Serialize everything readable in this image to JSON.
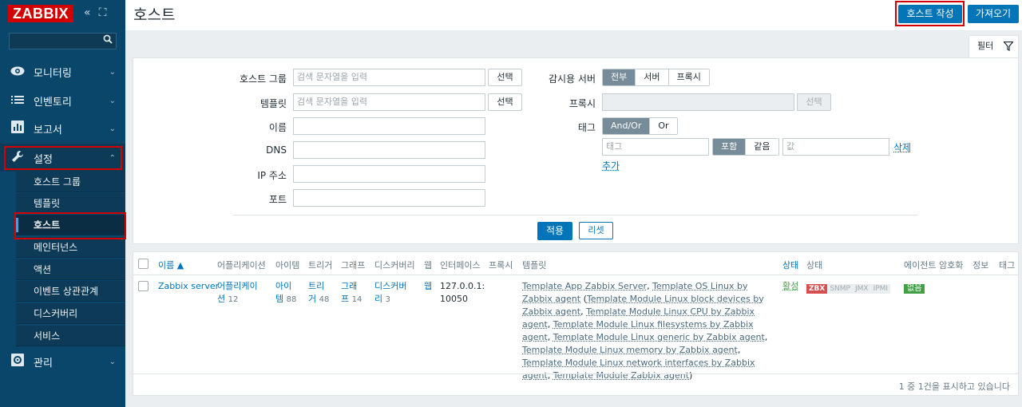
{
  "sidebar": {
    "logo": "ZABBIX",
    "collapse_icon": "«",
    "expand_icon": "⛶",
    "search_placeholder": "",
    "menu": [
      {
        "label": "모니터링",
        "icon": "eye-icon"
      },
      {
        "label": "인벤토리",
        "icon": "list-icon"
      },
      {
        "label": "보고서",
        "icon": "chart-icon"
      },
      {
        "label": "설정",
        "icon": "wrench-icon"
      },
      {
        "label": "관리",
        "icon": "gear-icon"
      }
    ],
    "submenu": [
      "호스트 그룹",
      "템플릿",
      "호스트",
      "메인터넌스",
      "액션",
      "이벤트 상관관계",
      "디스커버리",
      "서비스"
    ]
  },
  "header": {
    "title": "호스트",
    "create_button": "호스트 작성",
    "import_button": "가져오기"
  },
  "filter": {
    "tab_label": "필터",
    "host_group_label": "호스트 그룹",
    "host_group_placeholder": "검색 문자열을 입력",
    "template_label": "템플릿",
    "template_placeholder": "검색 문자열을 입력",
    "select_button": "선택",
    "name_label": "이름",
    "dns_label": "DNS",
    "ip_label": "IP 주소",
    "port_label": "포트",
    "monitored_by_label": "감시용 서버",
    "monitored_by_options": [
      "전부",
      "서버",
      "프록시"
    ],
    "proxy_label": "프록시",
    "proxy_select": "선택",
    "tags_label": "태그",
    "tags_logic": [
      "And/Or",
      "Or"
    ],
    "tag_placeholder": "태그",
    "tag_ops": [
      "포함",
      "같음"
    ],
    "value_placeholder": "값",
    "remove_link": "삭제",
    "add_link": "추가",
    "apply_button": "적용",
    "reset_button": "리셋"
  },
  "table": {
    "headers": [
      "이름 ▲",
      "어플리케이션",
      "아이템",
      "트리거",
      "그래프",
      "디스커버리",
      "웹",
      "인터페이스",
      "프록시",
      "템플릿",
      "상태",
      "상태",
      "에이전트 암호화",
      "정보",
      "태그"
    ],
    "row": {
      "name": "Zabbix server",
      "applications_l1": "어플리케이",
      "applications_l2": "션",
      "applications_count": "12",
      "items_l1": "아이",
      "items_l2": "템",
      "items_count": "88",
      "triggers_l1": "트리",
      "triggers_l2": "거",
      "triggers_count": "48",
      "graphs_l1": "그래",
      "graphs_l2": "프",
      "graphs_count": "14",
      "discovery_l1": "디스커버",
      "discovery_l2": "리",
      "discovery_count": "3",
      "web": "웹",
      "interface_l1": "127.0.0.1:",
      "interface_l2": "10050",
      "templates": [
        "Template App Zabbix Server",
        "Template OS Linux by Zabbix agent",
        "Template Module Linux block devices by Zabbix agent",
        "Template Module Linux CPU by Zabbix agent",
        "Template Module Linux filesystems by Zabbix agent",
        "Template Module Linux generic by Zabbix agent",
        "Template Module Linux memory by Zabbix agent",
        "Template Module Linux network interfaces by Zabbix agent",
        "Template Module Zabbix agent"
      ],
      "status": "활성",
      "availability": [
        "ZBX",
        "SNMP",
        "JMX",
        "IPMI"
      ],
      "encryption": "없음"
    },
    "footer": "1 중 1건을 표시하고 있습니다"
  },
  "colors": {
    "sidebar_bg": "#0a466a",
    "accent": "#0275b8",
    "zbx_red": "#d64e4e",
    "green": "#429e47"
  }
}
